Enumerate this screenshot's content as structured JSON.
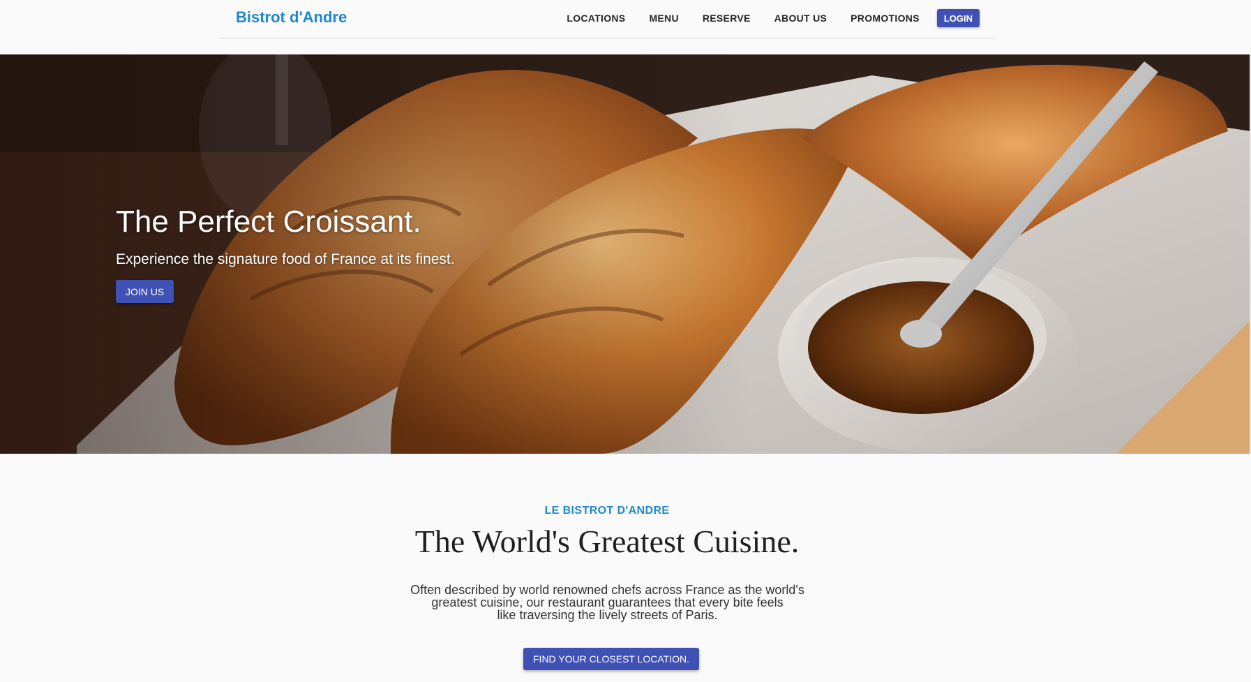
{
  "header": {
    "brand": "Bistrot d'Andre",
    "nav": [
      "LOCATIONS",
      "MENU",
      "RESERVE",
      "ABOUT US",
      "PROMOTIONS"
    ],
    "login_label": "LOGIN"
  },
  "hero": {
    "title": "The Perfect Croissant.",
    "subtitle": "Experience the signature food of France at its finest.",
    "cta_label": "JOIN US"
  },
  "intro": {
    "kicker": "LE BISTROT D'ANDRE",
    "title": "The World's Greatest Cuisine.",
    "body_lines": [
      "Often described by world renowned chefs across France as the world's",
      "greatest cuisine, our restaurant guarantees that every bite feels",
      "like traversing the lively streets of Paris."
    ],
    "cta_label": "FIND YOUR CLOSEST LOCATION."
  },
  "colors": {
    "brand": "#1f87cf",
    "primary_button": "#3f51b5"
  }
}
